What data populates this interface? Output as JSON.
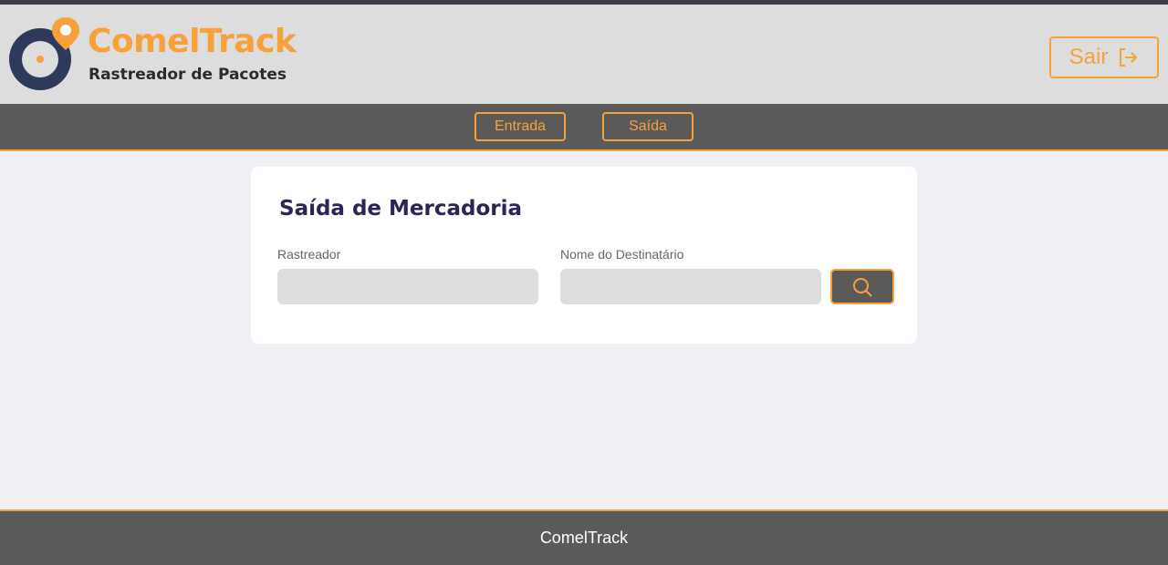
{
  "header": {
    "brand_name": "ComelTrack",
    "brand_subtitle": "Rastreador de Pacotes",
    "logout_label": "Sair",
    "logout_icon": "logout-icon",
    "logo_icon": "location-pin-disc-logo"
  },
  "nav": {
    "items": [
      {
        "label": "Entrada"
      },
      {
        "label": "Saída"
      }
    ]
  },
  "form": {
    "title": "Saída de Mercadoria",
    "rastreador_label": "Rastreador",
    "rastreador_value": "",
    "destinatario_label": "Nome do Destinatário",
    "destinatario_value": "",
    "search_icon": "search-icon"
  },
  "footer": {
    "text": "ComelTrack"
  },
  "colors": {
    "accent": "#f7a13b",
    "navy": "#2d3a5c",
    "title": "#2d2554",
    "bar": "#5a5a5a",
    "header_bg": "#dddddd",
    "page_bg": "#f0f0f4"
  }
}
